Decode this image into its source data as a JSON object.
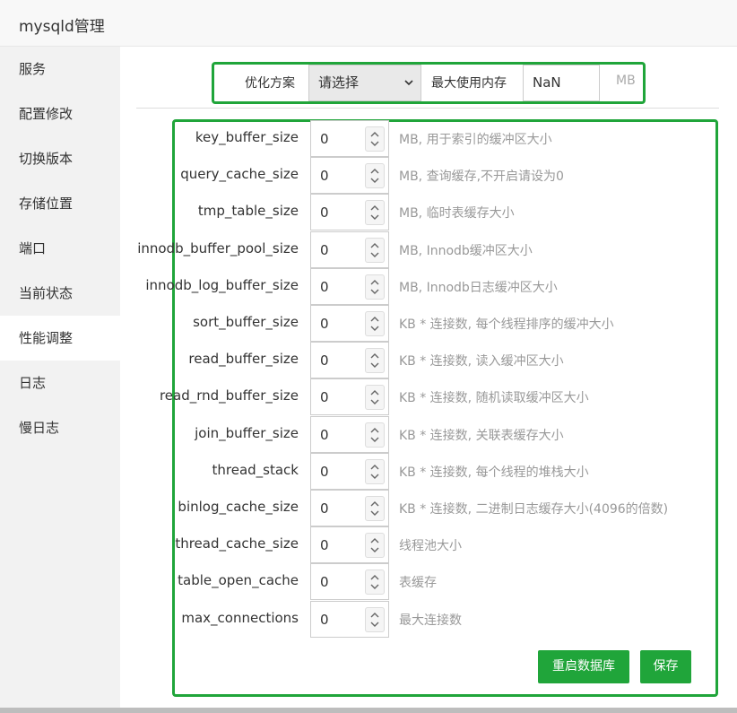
{
  "window": {
    "title": "mysqld管理",
    "close_glyph": "×"
  },
  "sidebar": {
    "items": [
      {
        "label": "服务",
        "active": false
      },
      {
        "label": "配置修改",
        "active": false
      },
      {
        "label": "切换版本",
        "active": false
      },
      {
        "label": "存储位置",
        "active": false
      },
      {
        "label": "端口",
        "active": false
      },
      {
        "label": "当前状态",
        "active": false
      },
      {
        "label": "性能调整",
        "active": true
      },
      {
        "label": "日志",
        "active": false
      },
      {
        "label": "慢日志",
        "active": false
      }
    ]
  },
  "top": {
    "scheme_label": "优化方案",
    "scheme_select": "请选择",
    "max_mem_label": "最大使用内存",
    "max_mem_value": "NaN",
    "max_mem_unit": "MB"
  },
  "fields": [
    {
      "name": "key_buffer_size",
      "value": "0",
      "hint": "MB, 用于索引的缓冲区大小"
    },
    {
      "name": "query_cache_size",
      "value": "0",
      "hint": "MB, 查询缓存,不开启请设为0"
    },
    {
      "name": "tmp_table_size",
      "value": "0",
      "hint": "MB, 临时表缓存大小"
    },
    {
      "name": "innodb_buffer_pool_size",
      "value": "0",
      "hint": "MB, Innodb缓冲区大小"
    },
    {
      "name": "innodb_log_buffer_size",
      "value": "0",
      "hint": "MB, Innodb日志缓冲区大小"
    },
    {
      "name": "sort_buffer_size",
      "value": "0",
      "hint": "KB * 连接数, 每个线程排序的缓冲大小"
    },
    {
      "name": "read_buffer_size",
      "value": "0",
      "hint": "KB * 连接数, 读入缓冲区大小"
    },
    {
      "name": "read_rnd_buffer_size",
      "value": "0",
      "hint": "KB * 连接数, 随机读取缓冲区大小"
    },
    {
      "name": "join_buffer_size",
      "value": "0",
      "hint": "KB * 连接数, 关联表缓存大小"
    },
    {
      "name": "thread_stack",
      "value": "0",
      "hint": "KB * 连接数, 每个线程的堆栈大小"
    },
    {
      "name": "binlog_cache_size",
      "value": "0",
      "hint": "KB * 连接数, 二进制日志缓存大小(4096的倍数)"
    },
    {
      "name": "thread_cache_size",
      "value": "0",
      "hint": "线程池大小"
    },
    {
      "name": "table_open_cache",
      "value": "0",
      "hint": "表缓存"
    },
    {
      "name": "max_connections",
      "value": "0",
      "hint": "最大连接数"
    }
  ],
  "buttons": {
    "restart": "重启数据库",
    "save": "保存"
  },
  "colors": {
    "accent": "#20a53a",
    "sidebar_bg": "#f2f2f2"
  }
}
